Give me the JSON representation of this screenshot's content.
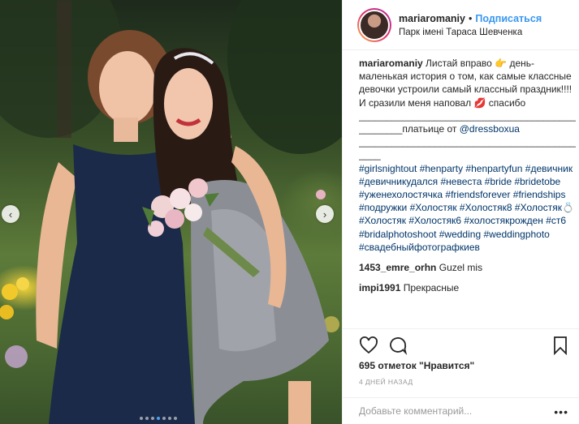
{
  "header": {
    "username": "mariaromaniy",
    "separator": "•",
    "follow_label": "Подписаться",
    "location": "Парк імені Тараса Шевченка"
  },
  "caption": {
    "username": "mariaromaniy",
    "text_1": "Листай вправо 👉 день-маленькая история о том, как самые классные девочки устроили самый классный праздник!!!! И сразили меня наповал 💋 спасибо",
    "divider_1": "________________________________________",
    "dress_prefix": "________платьице от",
    "dress_tag": "@dressboxua",
    "divider_2": "____________________________________________",
    "hashtags": "#girlsnightout #henparty #henpartyfun #девичник #девичникудался #невеста #bride #bridetobe #уженехолостячка #friendsforever #friendships #подружки #Холостяк #Холостяк8 #Холостяк💍 #Холостяк #Холостяк6 #холостякрожден #ст6 #bridalphotoshoot #wedding #weddingphoto #свадебныйфотографкиев"
  },
  "comments": [
    {
      "username": "1453_emre_orhn",
      "text": "Guzel mis"
    },
    {
      "username": "impi1991",
      "text": "Прекрасные"
    }
  ],
  "actions": {
    "like_icon": "heart-icon",
    "comment_icon": "speech-bubble-icon",
    "save_icon": "bookmark-icon"
  },
  "likes_text": "695 отметок \"Нравится\"",
  "timestamp": "4 ДНЕЙ НАЗАД",
  "add_comment": {
    "placeholder": "Добавьте комментарий...",
    "more_label": "•••"
  },
  "carousel": {
    "prev_label": "‹",
    "next_label": "›",
    "total_slides": 7,
    "active_slide": 4
  },
  "colors": {
    "link_blue": "#3897f0",
    "hashtag": "#003569",
    "muted": "#999999",
    "border": "#efefef"
  }
}
